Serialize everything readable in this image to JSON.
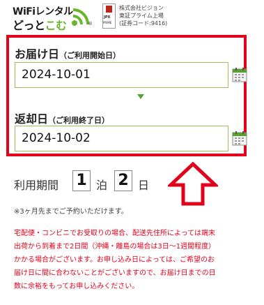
{
  "header": {
    "logo_line1": "WiFiレンタル",
    "logo_line2_a": "どっと",
    "logo_line2_b": "こむ",
    "logo_reg": "®",
    "jpx_name": "JPX",
    "jpx_sub": "PRIME",
    "company_lines": [
      "株式会社ビジョン",
      "東証プライム上場",
      "(証券コード:9416)"
    ]
  },
  "delivery": {
    "title": "お届け日",
    "subtitle": "（ご利用開始日）",
    "value": "2024-10-01"
  },
  "return": {
    "title": "返却日",
    "subtitle": "（ご利用終了日）",
    "value": "2024-10-02"
  },
  "period": {
    "label": "利用期間",
    "nights": "1",
    "nights_unit": "泊",
    "days": "2",
    "days_unit": "日"
  },
  "note": "※3ヶ月先までご予約いただけます。",
  "warning_lines": [
    "宅配便・コンビニでお受取りの場合、配送先住所によっては端末",
    "出荷から到着まで2日間（沖縄・離島の場合は3日〜1週間程度）",
    "かかる場合がございます。お申し込み日によっては、ご希望のお",
    "届け日に間に合わないことがございますので、お届け日までの日",
    "数に余裕をもってお申し込みください。"
  ],
  "colors": {
    "accent_red": "#e3001b",
    "accent_green": "#6bb52c",
    "input_border": "#9bc35a"
  },
  "icons": {
    "calendar": "calendar-icon",
    "wifi": "wifi-icon",
    "big_arrow": "arrow-up-icon"
  }
}
